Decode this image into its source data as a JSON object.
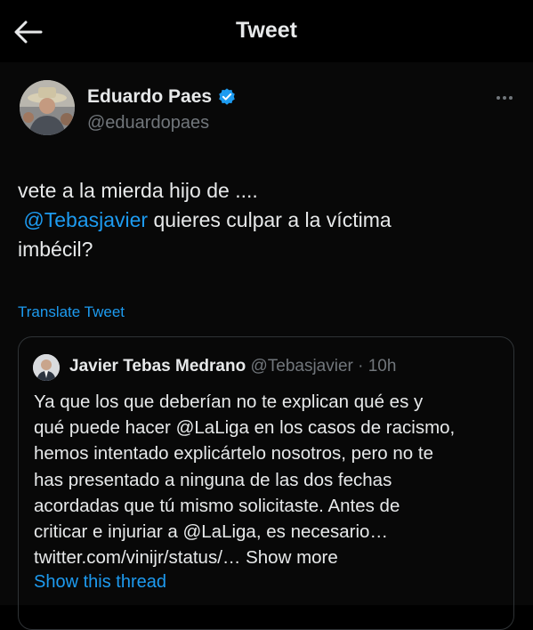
{
  "header": {
    "title": "Tweet"
  },
  "tweet": {
    "author_name": "Eduardo Paes",
    "author_handle": "@eduardopaes",
    "text_line1": "vete a la mierda hijo de ....",
    "mention": "@Tebasjavier",
    "text_line2_rest": " quieres culpar a la víctima",
    "text_line3": "imbécil?",
    "translate_label": "Translate Tweet"
  },
  "quoted": {
    "author_name": "Javier Tebas Medrano",
    "meta": "@Tebasjavier · 10h",
    "lines": [
      "Ya que los que deberían no te explican qué es y",
      "qué puede hacer @LaLiga en los casos de racismo,",
      "hemos intentado explicártelo nosotros, pero no te",
      "has presentado a ninguna de las dos fechas",
      "acordadas que tú mismo solicitaste. Antes de",
      "criticar e injuriar a @LaLiga, es necesario…"
    ],
    "link_text": "twitter.com/vinijr/status/…",
    "show_more": "Show more",
    "show_thread": "Show this thread"
  },
  "colors": {
    "accent": "#1d9bf0",
    "background": "#000000",
    "text": "#e7e9ea",
    "secondary_text": "#71767b",
    "verified_badge": "#1d9bf0"
  },
  "icons": {
    "back": "arrow-left-icon",
    "verified": "verified-badge-icon",
    "more": "more-horizontal-icon"
  }
}
